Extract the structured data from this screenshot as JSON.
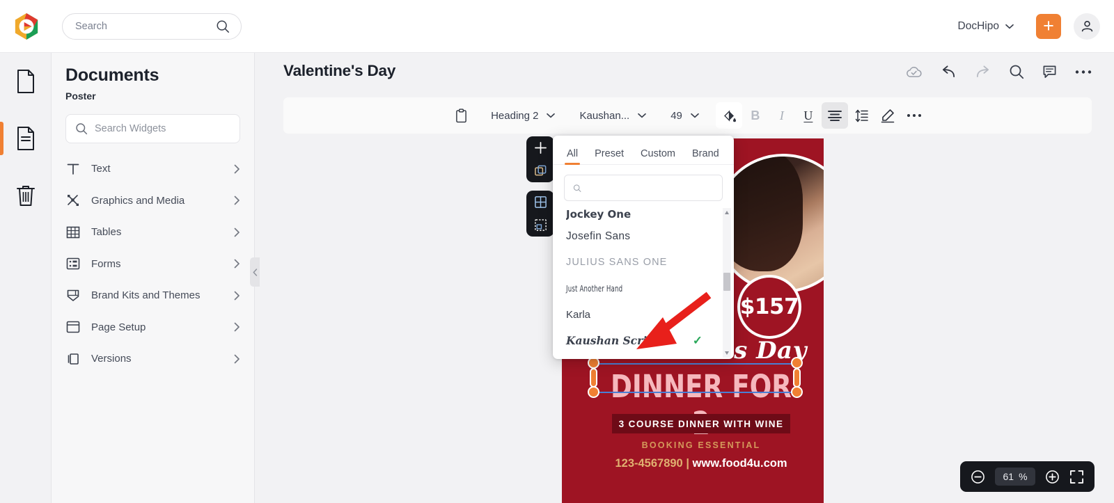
{
  "app": {
    "brand_color": "#f08033",
    "logo_colors": [
      "#e03a2f",
      "#f0a92b",
      "#1a9e55"
    ]
  },
  "topbar": {
    "search_placeholder": "Search",
    "search_value": "",
    "search_icon": "search-icon",
    "workspace": "DocHipo",
    "workspace_chevron": "chevron-down-icon",
    "create_label": "+",
    "account_icon": "person-icon"
  },
  "rail": {
    "items": [
      {
        "icon": "file-icon",
        "active": false
      },
      {
        "icon": "document-lines-icon",
        "active": true
      },
      {
        "icon": "trash-icon",
        "active": false
      }
    ]
  },
  "panel": {
    "title": "Documents",
    "subtitle": "Poster",
    "search_placeholder": "Search Widgets",
    "search_value": "",
    "collapse_icon": "chevron-left-icon",
    "items": [
      {
        "label": "Text",
        "icon": "text-t-icon"
      },
      {
        "label": "Graphics and Media",
        "icon": "graphics-media-icon"
      },
      {
        "label": "Tables",
        "icon": "table-grid-icon"
      },
      {
        "label": "Forms",
        "icon": "forms-icon"
      },
      {
        "label": "Brand Kits and Themes",
        "icon": "brand-kit-icon"
      },
      {
        "label": "Page Setup",
        "icon": "page-setup-icon"
      },
      {
        "label": "Versions",
        "icon": "versions-icon"
      }
    ]
  },
  "document": {
    "title": "Valentine's Day",
    "actions": [
      {
        "name": "cloud-saved-icon",
        "label": "Saved"
      },
      {
        "name": "undo-icon",
        "label": "Undo"
      },
      {
        "name": "redo-icon",
        "label": "Redo"
      },
      {
        "name": "search-icon",
        "label": "Find"
      },
      {
        "name": "comment-icon",
        "label": "Comments"
      },
      {
        "name": "more-horizontal-icon",
        "label": "More"
      }
    ]
  },
  "toolbar": {
    "clipboard_label": "",
    "style_value": "Heading 2",
    "font_value": "Kaushan...",
    "size_value": "49",
    "bold_label": "B",
    "italic_label": "I",
    "underline_label": "U",
    "buttons": [
      {
        "name": "format-painter-icon",
        "state": "white"
      },
      {
        "name": "bold-icon",
        "state": "disabled"
      },
      {
        "name": "italic-icon",
        "state": "normal"
      },
      {
        "name": "underline-icon",
        "state": "normal"
      },
      {
        "name": "align-center-icon",
        "state": "active"
      },
      {
        "name": "line-height-icon",
        "state": "normal"
      },
      {
        "name": "highlighter-pen-icon",
        "state": "normal"
      },
      {
        "name": "more-horizontal-icon",
        "state": "normal"
      }
    ]
  },
  "canvas_tools": {
    "stack_one": [
      "add-page-icon",
      "duplicate-page-icon"
    ],
    "stack_two": [
      "grid-layout-icon",
      "select-area-icon"
    ]
  },
  "font_dropdown": {
    "tabs": [
      {
        "label": "All",
        "active": true
      },
      {
        "label": "Preset",
        "active": false
      },
      {
        "label": "Custom",
        "active": false
      },
      {
        "label": "Brand",
        "active": false
      }
    ],
    "search_placeholder": "",
    "search_value": "",
    "search_icon": "search-icon",
    "options": [
      {
        "name": "Jockey One",
        "selected": false,
        "style": "f-jockey"
      },
      {
        "name": "Josefin Sans",
        "selected": false,
        "style": "f-josefin"
      },
      {
        "name": "JULIUS SANS ONE",
        "selected": false,
        "style": "f-julius"
      },
      {
        "name": "Just Another Hand",
        "selected": false,
        "style": "f-hand"
      },
      {
        "name": "Karla",
        "selected": false,
        "style": "f-karla"
      },
      {
        "name": "Kaushan Script",
        "selected": true,
        "style": "f-kaushan"
      }
    ],
    "selected_mark": "✓",
    "selected_color": "#2aa85a",
    "annotation": {
      "type": "arrow",
      "color": "#e8201b",
      "points_to": "Kaushan Script"
    }
  },
  "poster": {
    "background_color": "#9e1423",
    "price": "$157",
    "script_line": "Valentine's Day",
    "headline": "DINNER FOR 2",
    "ribbon": "3 COURSE DINNER WITH WINE",
    "gold_line": "BOOKING ESSENTIAL",
    "phone": "123-4567890",
    "separator": "|",
    "website": "www.food4u.com",
    "selection": {
      "handle_color": "#f08033",
      "border_color": "#4a7fd4"
    }
  },
  "zoom": {
    "minus_icon": "zoom-out-icon",
    "value": "61",
    "unit": "%",
    "plus_icon": "zoom-in-icon",
    "fullscreen_icon": "fullscreen-icon"
  }
}
